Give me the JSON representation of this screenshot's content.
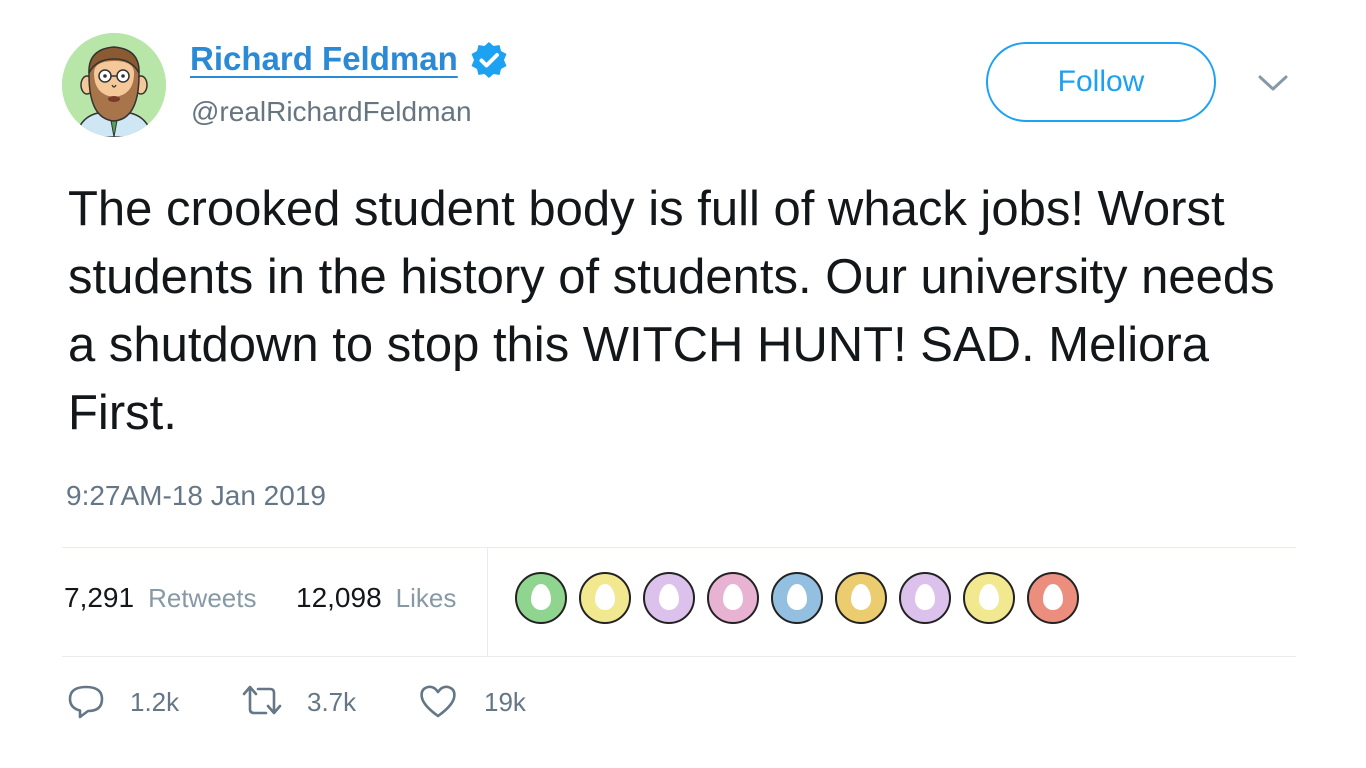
{
  "author": {
    "name": "Richard Feldman",
    "handle": "@realRichardFeldman",
    "verified": true,
    "avatar": "cartoon-avatar-bearded-man"
  },
  "follow_label": "Follow",
  "menu_icon": "chevron-down-icon",
  "tweet": {
    "text": "The crooked student body is full of whack jobs! Worst students in the history of students. Our university needs a shutdown to stop this WITCH HUNT! SAD. Meliora First.",
    "timestamp": "9:27AM-18 Jan 2019"
  },
  "stats": {
    "retweets_count": "7,291",
    "retweets_label": "Retweets",
    "likes_count": "12,098",
    "likes_label": "Likes"
  },
  "likers": [
    {
      "color": "#8fd48f"
    },
    {
      "color": "#f1e890"
    },
    {
      "color": "#dcc1ec"
    },
    {
      "color": "#e8b2d2"
    },
    {
      "color": "#93bfe0"
    },
    {
      "color": "#ebcc6e"
    },
    {
      "color": "#dcc1ec"
    },
    {
      "color": "#f1e890"
    },
    {
      "color": "#ec8e7e"
    }
  ],
  "actions": {
    "reply_count": "1.2k",
    "retweet_count": "3.7k",
    "like_count": "19k"
  },
  "colors": {
    "link": "#2a8ad6",
    "accent": "#1da1f2",
    "muted": "#657786",
    "text": "#14171a"
  }
}
